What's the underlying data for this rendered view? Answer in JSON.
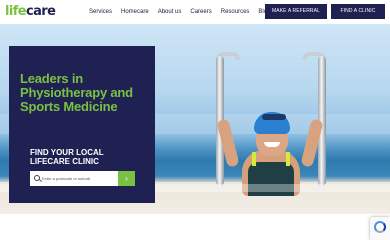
{
  "brand": {
    "logo_life": "life",
    "logo_care": "care",
    "logo_green": "#7ac143",
    "logo_navy": "#1f2152"
  },
  "nav": {
    "items": [
      "Services",
      "Homecare",
      "About us",
      "Careers",
      "Resources",
      "Blog"
    ]
  },
  "header_buttons": {
    "referral": "MAKE A REFERRAL",
    "clinic": "FIND A CLINIC"
  },
  "hero": {
    "headline": "Leaders in Physiotherapy and Sports Medicine",
    "subheading": "FIND YOUR LOCAL LIFECARE CLINIC",
    "search_placeholder": "Enter a postcode or suburb",
    "go_label": "›"
  },
  "colors": {
    "accent": "#7ac143",
    "navy": "#1f2152"
  },
  "icons": {
    "search": "search-icon",
    "go": "chevron-right-icon",
    "recaptcha": "recaptcha-icon"
  }
}
